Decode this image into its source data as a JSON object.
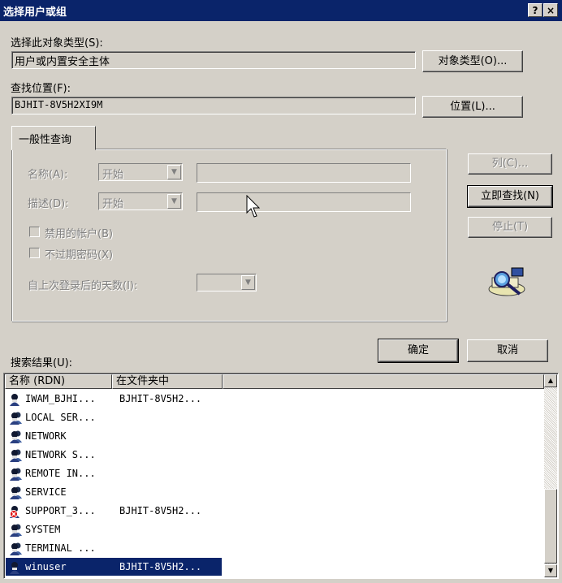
{
  "window": {
    "title": "选择用户或组",
    "help_btn": "?",
    "close_btn": "×"
  },
  "object_type": {
    "label": "选择此对象类型(S):",
    "value": "用户或内置安全主体",
    "button": "对象类型(O)..."
  },
  "location": {
    "label": "查找位置(F):",
    "value": "BJHIT-8V5H2XI9M",
    "button": "位置(L)..."
  },
  "tab": {
    "label": "一般性查询"
  },
  "query": {
    "name_label": "名称(A):",
    "name_op": "开始",
    "desc_label": "描述(D):",
    "desc_op": "开始",
    "disabled_accounts": "禁用的帐户(B)",
    "no_expire_pwd": "不过期密码(X)",
    "days_label": "自上次登录后的天数(I):"
  },
  "side_buttons": {
    "columns": "列(C)...",
    "find_now": "立即查找(N)",
    "stop": "停止(T)"
  },
  "dialog_buttons": {
    "ok": "确定",
    "cancel": "取消"
  },
  "results": {
    "label": "搜索结果(U):",
    "columns": [
      "名称 (RDN)",
      "在文件夹中"
    ],
    "rows": [
      {
        "name": "IWAM_BJHI...",
        "folder": "BJHIT-8V5H2..."
      },
      {
        "name": "LOCAL SER...",
        "folder": ""
      },
      {
        "name": "NETWORK",
        "folder": ""
      },
      {
        "name": "NETWORK S...",
        "folder": ""
      },
      {
        "name": "REMOTE IN...",
        "folder": ""
      },
      {
        "name": "SERVICE",
        "folder": ""
      },
      {
        "name": "SUPPORT_3...",
        "folder": "BJHIT-8V5H2..."
      },
      {
        "name": "SYSTEM",
        "folder": ""
      },
      {
        "name": "TERMINAL ...",
        "folder": ""
      },
      {
        "name": "winuser",
        "folder": "BJHIT-8V5H2..."
      }
    ]
  },
  "colors": {
    "titlebar": "#0a246a",
    "face": "#d4d0c8",
    "selection": "#0a246a"
  }
}
